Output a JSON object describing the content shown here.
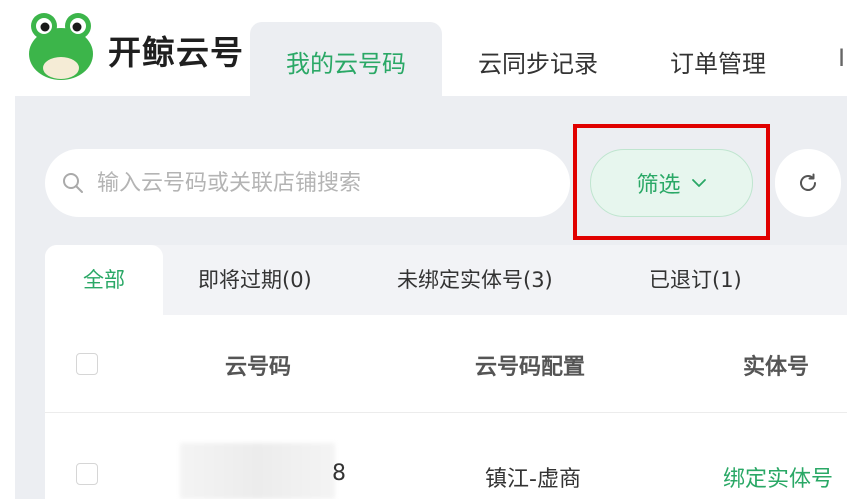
{
  "app": {
    "brand": "开鲸云号",
    "nav": [
      {
        "label": "我的云号码",
        "active": true
      },
      {
        "label": "云同步记录",
        "active": false
      },
      {
        "label": "订单管理",
        "active": false
      },
      {
        "label": "I",
        "active": false
      }
    ]
  },
  "toolbar": {
    "search_placeholder": "输入云号码或关联店铺搜索",
    "filter_label": "筛选"
  },
  "table": {
    "tabs": [
      {
        "label": "全部",
        "active": true
      },
      {
        "label": "即将过期(0)",
        "active": false
      },
      {
        "label": "未绑定实体号(3)",
        "active": false
      },
      {
        "label": "已退订(1)",
        "active": false
      }
    ],
    "columns": [
      "云号码",
      "云号码配置",
      "实体号"
    ],
    "rows": [
      {
        "number_visible_suffix": "8",
        "config": "镇江-虚商",
        "action": "绑定实体号"
      }
    ]
  },
  "colors": {
    "accent": "#2aa866",
    "highlight": "#e00000",
    "content_bg": "#eceef2"
  },
  "icons": [
    "frog-logo-icon",
    "search-icon",
    "chevron-down-icon",
    "refresh-icon"
  ]
}
